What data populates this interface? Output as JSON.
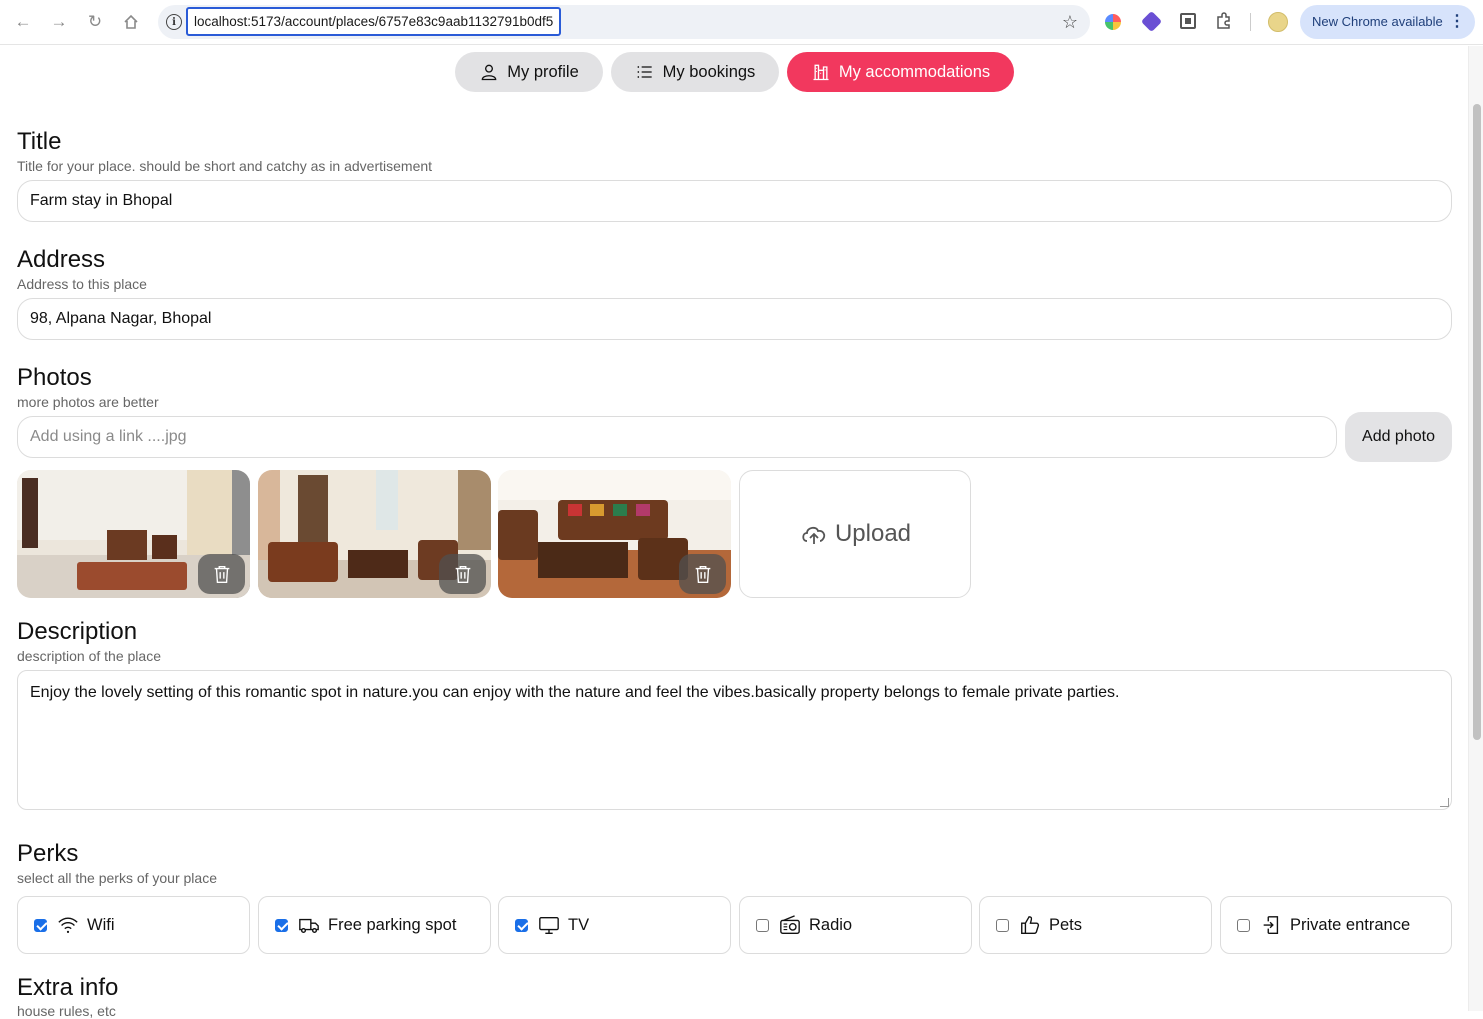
{
  "browser": {
    "url": "localhost:5173/account/places/6757e83c9aab1132791b0df5",
    "update_label": "New Chrome available"
  },
  "tabs": [
    {
      "label": "My profile",
      "active": false
    },
    {
      "label": "My bookings",
      "active": false
    },
    {
      "label": "My accommodations",
      "active": true
    }
  ],
  "form": {
    "title": {
      "heading": "Title",
      "subtitle": "Title for your place. should be short and catchy as in advertisement",
      "value": "Farm stay in Bhopal"
    },
    "address": {
      "heading": "Address",
      "subtitle": "Address to this place",
      "value": "98, Alpana Nagar, Bhopal"
    },
    "photos": {
      "heading": "Photos",
      "subtitle": "more photos are better",
      "link_placeholder": "Add using a link ....jpg",
      "add_button": "Add photo",
      "upload_label": "Upload"
    },
    "description": {
      "heading": "Description",
      "subtitle": "description of the place",
      "value": "Enjoy the lovely setting of this romantic spot in nature.you can enjoy with the nature and feel the vibes.basically property belongs to female private parties."
    },
    "perks": {
      "heading": "Perks",
      "subtitle": "select all the perks of your place",
      "items": [
        {
          "label": "Wifi",
          "checked": true,
          "icon": "wifi-icon"
        },
        {
          "label": "Free parking spot",
          "checked": true,
          "icon": "truck-icon"
        },
        {
          "label": "TV",
          "checked": true,
          "icon": "tv-icon"
        },
        {
          "label": "Radio",
          "checked": false,
          "icon": "radio-icon"
        },
        {
          "label": "Pets",
          "checked": false,
          "icon": "thumb-up-icon"
        },
        {
          "label": "Private entrance",
          "checked": false,
          "icon": "entrance-icon"
        }
      ]
    },
    "extra": {
      "heading": "Extra info",
      "subtitle": "house rules, etc"
    }
  },
  "colors": {
    "accent": "#f2385e",
    "checkbox": "#1a6fe8"
  }
}
